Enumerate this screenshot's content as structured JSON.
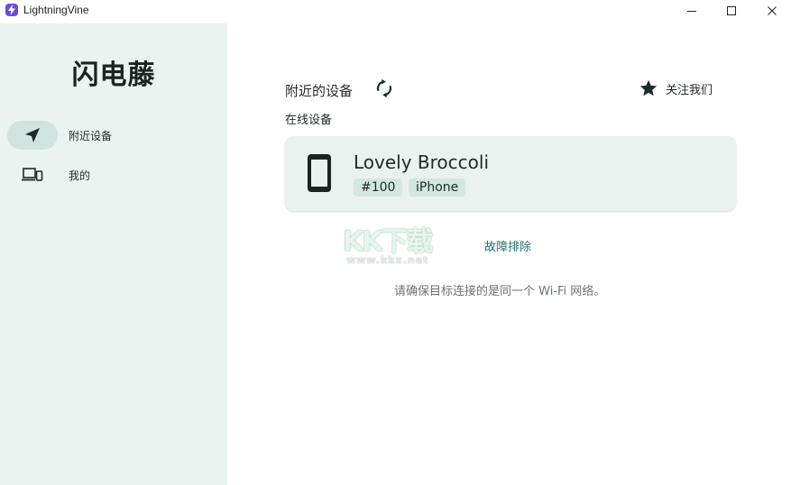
{
  "window": {
    "title": "LightningVine"
  },
  "sidebar": {
    "app_name": "闪电藤",
    "items": [
      {
        "label": "附近设备",
        "icon": "navigation-arrow-icon",
        "selected": true
      },
      {
        "label": "我的",
        "icon": "devices-icon",
        "selected": false
      }
    ]
  },
  "main": {
    "section_title": "附近的设备",
    "follow_label": "关注我们",
    "online_label": "在线设备",
    "device": {
      "name": "Lovely Broccoli",
      "tags": [
        "#100",
        "iPhone"
      ],
      "icon": "phone-icon"
    },
    "troubleshoot_label": "故障排除",
    "hint": "请确保目标连接的是同一个 Wi-Fi 网络。"
  },
  "watermark": {
    "text": "KK下载",
    "url": "www.kkx.net"
  },
  "colors": {
    "sidebar_bg": "#eaf3f0",
    "selected_pill": "#cfe4de",
    "card_bg": "#e9f2ef",
    "tag_bg": "#d3e6e0",
    "link": "#1f6e6a",
    "app_icon": "#6c4bd8"
  }
}
